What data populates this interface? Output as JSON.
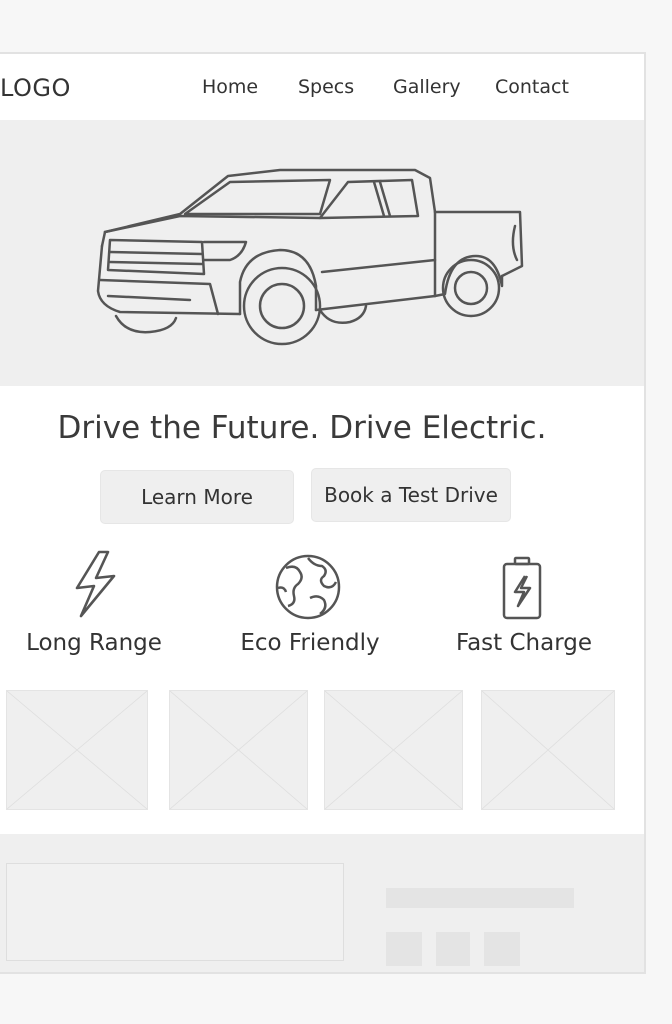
{
  "header": {
    "logo": "LOGO",
    "nav": [
      "Home",
      "Specs",
      "Gallery",
      "Contact"
    ]
  },
  "hero": {
    "image_icon": "pickup-truck-illustration",
    "headline": "Drive the Future. Drive Electric."
  },
  "cta": {
    "learn_more": "Learn More",
    "test_drive": "Book a Test Drive"
  },
  "features": [
    {
      "label": "Long Range",
      "icon": "lightning-bolt-icon"
    },
    {
      "label": "Eco Friendly",
      "icon": "globe-icon"
    },
    {
      "label": "Fast Charge",
      "icon": "battery-charge-icon"
    }
  ],
  "gallery": {
    "placeholder_count_icon": "image-placeholder-icon"
  },
  "colors": {
    "page_bg": "#f7f7f7",
    "panel_bg": "#efefef",
    "line": "#555555",
    "text": "#333333"
  }
}
